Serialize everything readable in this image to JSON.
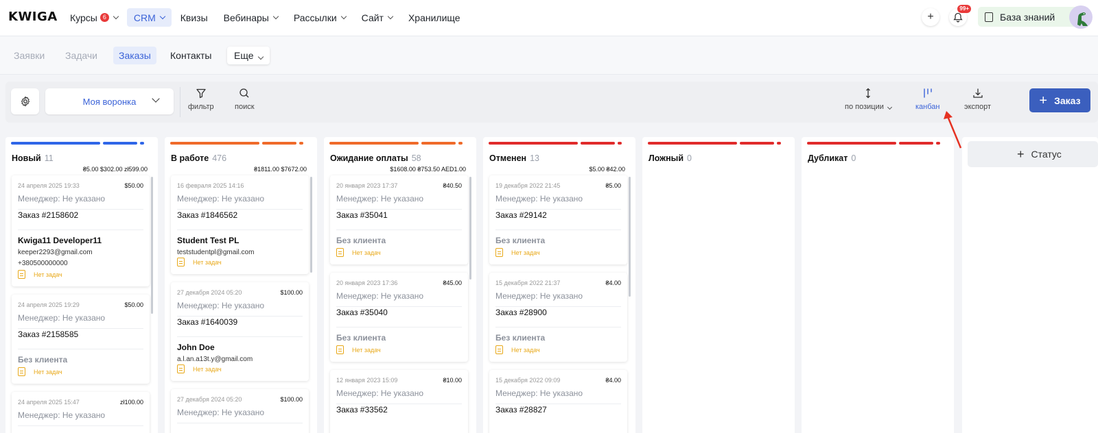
{
  "app": {
    "logo": "KWIGA"
  },
  "nav": {
    "items": [
      {
        "label": "Курсы",
        "badge": "6",
        "has_chevron": true
      },
      {
        "label": "CRM",
        "has_chevron": true,
        "active": true
      },
      {
        "label": "Квизы"
      },
      {
        "label": "Вебинары",
        "has_chevron": true
      },
      {
        "label": "Рассылки",
        "has_chevron": true
      },
      {
        "label": "Сайт",
        "has_chevron": true
      },
      {
        "label": "Хранилище"
      }
    ],
    "add_label": "+",
    "notifications_badge": "99+",
    "knowledge_base_label": "База знаний"
  },
  "subnav": {
    "items": [
      {
        "label": "Заявки"
      },
      {
        "label": "Задачи"
      },
      {
        "label": "Заказы",
        "active": true
      },
      {
        "label": "Контакты"
      }
    ],
    "more_label": "Еще"
  },
  "toolbar": {
    "funnel_value": "Моя воронка",
    "filter_label": "фильтр",
    "search_label": "поиск",
    "sort_label": "по позиции",
    "kanban_label": "канбан",
    "export_label": "экспорт",
    "order_button_label": "Заказ",
    "colors": {
      "accent": "#3b63d8",
      "primary_button": "#3b5fbe"
    }
  },
  "board": {
    "add_status_label": "Статус",
    "columns": [
      {
        "name": "Новый",
        "count": "11",
        "sum": "₴5.00 $302.00 zł599.00",
        "color": "#2f66e8",
        "cards": [
          {
            "date": "24 апреля 2025 19:33",
            "amount": "$50.00",
            "manager": "Менеджер: Не указано",
            "order": "Заказ #2158602",
            "client": "Kwiga11 Developer11",
            "email": "keeper2293@gmail.com",
            "phone": "+380500000000",
            "tasks": "Нет задач"
          },
          {
            "date": "24 апреля 2025 19:29",
            "amount": "$50.00",
            "manager": "Менеджер: Не указано",
            "order": "Заказ #2158585",
            "client": "Без клиента",
            "tasks": "Нет задач"
          },
          {
            "date": "24 апреля 2025 15:47",
            "amount": "zł100.00",
            "manager": "Менеджер: Не указано"
          }
        ]
      },
      {
        "name": "В работе",
        "count": "476",
        "sum": "₴1811.00 $7672.00",
        "color": "#ef6a2a",
        "cards": [
          {
            "date": "16 февраля 2025 14:16",
            "amount": "",
            "manager": "Менеджер: Не указано",
            "order": "Заказ #1846562",
            "client": "Student Test PL",
            "email": "teststudentpl@gmail.com",
            "tasks": "Нет задач"
          },
          {
            "date": "27 декабря 2024 05:20",
            "amount": "$100.00",
            "manager": "Менеджер: Не указано",
            "order": "Заказ #1640039",
            "client": "John Doe",
            "email": "a.l.an.a13t.y@gmail.com",
            "tasks": "Нет задач"
          },
          {
            "date": "27 декабря 2024 05:20",
            "amount": "$100.00",
            "manager": "Менеджер: Не указано"
          }
        ]
      },
      {
        "name": "Ожидание оплаты",
        "count": "58",
        "sum": "$1608.00 ₴753.50 AED1.00",
        "color": "#ef6a2a",
        "cards": [
          {
            "date": "20 января 2023 17:37",
            "amount": "₴40.50",
            "manager": "Менеджер: Не указано",
            "order": "Заказ #35041",
            "client": "Без клиента",
            "tasks": "Нет задач"
          },
          {
            "date": "20 января 2023 17:36",
            "amount": "₴45.00",
            "manager": "Менеджер: Не указано",
            "order": "Заказ #35040",
            "client": "Без клиента",
            "tasks": "Нет задач"
          },
          {
            "date": "12 января 2023 15:09",
            "amount": "₴10.00",
            "manager": "Менеджер: Не указано",
            "order": "Заказ #33562"
          }
        ]
      },
      {
        "name": "Отменен",
        "count": "13",
        "sum": "$5.00 ₴42.00",
        "color": "#e02b2b",
        "cards": [
          {
            "date": "19 декабря 2022 21:45",
            "amount": "₴5.00",
            "manager": "Менеджер: Не указано",
            "order": "Заказ #29142",
            "client": "Без клиента",
            "tasks": "Нет задач"
          },
          {
            "date": "15 декабря 2022 21:37",
            "amount": "₴4.00",
            "manager": "Менеджер: Не указано",
            "order": "Заказ #28900",
            "client": "Без клиента",
            "tasks": "Нет задач"
          },
          {
            "date": "15 декабря 2022 09:09",
            "amount": "₴4.00",
            "manager": "Менеджер: Не указано",
            "order": "Заказ #28827"
          }
        ]
      },
      {
        "name": "Ложный",
        "count": "0",
        "color": "#e02b2b",
        "cards": []
      },
      {
        "name": "Дубликат",
        "count": "0",
        "color": "#e02b2b",
        "cards": []
      }
    ]
  }
}
